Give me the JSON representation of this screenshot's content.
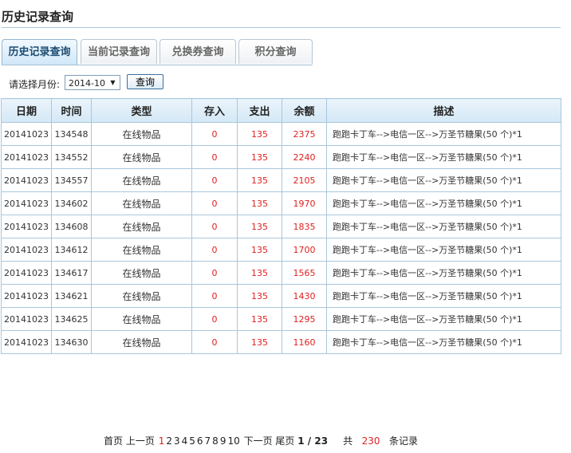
{
  "page_title": "历史记录查询",
  "tabs": [
    {
      "label": "历史记录查询",
      "active": true
    },
    {
      "label": "当前记录查询",
      "active": false
    },
    {
      "label": "兑换券查询",
      "active": false
    },
    {
      "label": "积分查询",
      "active": false
    }
  ],
  "filter": {
    "label": "请选择月份:",
    "selected_month": "2014-10",
    "query_button": "查询"
  },
  "table": {
    "headers": [
      "日期",
      "时间",
      "类型",
      "存入",
      "支出",
      "余额",
      "描述"
    ],
    "rows": [
      [
        "20141023",
        "134548",
        "在线物品",
        "0",
        "135",
        "2375",
        "跑跑卡丁车-->电信一区-->万圣节糖果(50 个)*1"
      ],
      [
        "20141023",
        "134552",
        "在线物品",
        "0",
        "135",
        "2240",
        "跑跑卡丁车-->电信一区-->万圣节糖果(50 个)*1"
      ],
      [
        "20141023",
        "134557",
        "在线物品",
        "0",
        "135",
        "2105",
        "跑跑卡丁车-->电信一区-->万圣节糖果(50 个)*1"
      ],
      [
        "20141023",
        "134602",
        "在线物品",
        "0",
        "135",
        "1970",
        "跑跑卡丁车-->电信一区-->万圣节糖果(50 个)*1"
      ],
      [
        "20141023",
        "134608",
        "在线物品",
        "0",
        "135",
        "1835",
        "跑跑卡丁车-->电信一区-->万圣节糖果(50 个)*1"
      ],
      [
        "20141023",
        "134612",
        "在线物品",
        "0",
        "135",
        "1700",
        "跑跑卡丁车-->电信一区-->万圣节糖果(50 个)*1"
      ],
      [
        "20141023",
        "134617",
        "在线物品",
        "0",
        "135",
        "1565",
        "跑跑卡丁车-->电信一区-->万圣节糖果(50 个)*1"
      ],
      [
        "20141023",
        "134621",
        "在线物品",
        "0",
        "135",
        "1430",
        "跑跑卡丁车-->电信一区-->万圣节糖果(50 个)*1"
      ],
      [
        "20141023",
        "134625",
        "在线物品",
        "0",
        "135",
        "1295",
        "跑跑卡丁车-->电信一区-->万圣节糖果(50 个)*1"
      ],
      [
        "20141023",
        "134630",
        "在线物品",
        "0",
        "135",
        "1160",
        "跑跑卡丁车-->电信一区-->万圣节糖果(50 个)*1"
      ]
    ]
  },
  "pager": {
    "first": "首页",
    "prev": "上一页",
    "pages": [
      "1",
      "2",
      "3",
      "4",
      "5",
      "6",
      "7",
      "8",
      "9",
      "10"
    ],
    "current_page": "1",
    "next": "下一页",
    "last": "尾页",
    "page_indicator": "1 / 23",
    "total_prefix": "共",
    "total_count": "230",
    "total_suffix": "条记录"
  },
  "colors": {
    "accent": "#1f4d72",
    "highlight_red": "#e02020",
    "border": "#a9c6dc"
  }
}
